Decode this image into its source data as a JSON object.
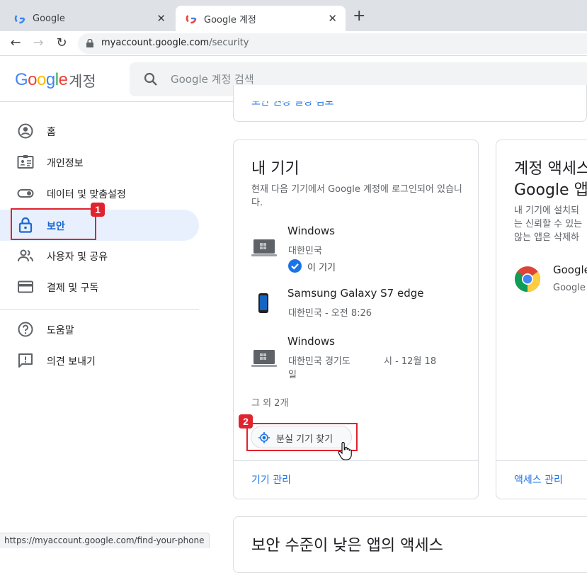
{
  "browser": {
    "tabs": [
      {
        "title": "Google"
      },
      {
        "title": "Google 계정"
      }
    ],
    "new_tab": "+",
    "url_domain": "myaccount.google.com",
    "url_path": "/security",
    "status_url": "https://myaccount.google.com/find-your-phone"
  },
  "header": {
    "logo_letters": [
      "G",
      "o",
      "o",
      "g",
      "l",
      "e"
    ],
    "product": "계정",
    "search_placeholder": "Google 계정 검색"
  },
  "sidebar": {
    "items": [
      {
        "label": "홈",
        "icon": "account-circle-icon"
      },
      {
        "label": "개인정보",
        "icon": "id-card-icon"
      },
      {
        "label": "데이터 및 맞춤설정",
        "icon": "toggle-icon"
      },
      {
        "label": "보안",
        "icon": "lock-icon",
        "active": true
      },
      {
        "label": "사용자 및 공유",
        "icon": "people-icon"
      },
      {
        "label": "결제 및 구독",
        "icon": "credit-card-icon"
      }
    ],
    "footer": [
      {
        "label": "도움말",
        "icon": "help-icon"
      },
      {
        "label": "의견 보내기",
        "icon": "feedback-icon"
      }
    ]
  },
  "prev_card": {
    "link": "보안 권장 설정 검토"
  },
  "devices_card": {
    "title": "내 기기",
    "description": "현재 다음 기기에서 Google 계정에 로그인되어 있습니다.",
    "devices": [
      {
        "name": "Windows",
        "detail": "대한민국",
        "extra": "이 기기",
        "icon": "laptop-icon"
      },
      {
        "name": "Samsung Galaxy S7 edge",
        "detail": "대한민국 - 오전 8:26",
        "icon": "phone-icon"
      },
      {
        "name": "Windows",
        "detail": "대한민국 경기도",
        "detail_right": "시 - 12월 18",
        "detail_wrap": "일",
        "icon": "laptop-icon"
      }
    ],
    "more": "그 외 2개",
    "find_button": "분실 기기 찾기",
    "manage_link": "기기 관리"
  },
  "access_card": {
    "title_line1": "계정 액세스",
    "title_line2": "Google 앱",
    "desc_line1": "내 기기에 설치되",
    "desc_line2": "는 신뢰할 수 있는",
    "desc_line3": "않는 앱은 삭제하",
    "app_name": "Google",
    "app_sub": "Google",
    "manage_link": "액세스 관리"
  },
  "bottom_card": {
    "title": "보안 수준이 낮은 앱의 액세스"
  },
  "annotations": {
    "badge1": "1",
    "badge2": "2"
  },
  "colors": {
    "accent": "#1a73e8",
    "active_bg": "#e8f0fe",
    "annotation_red": "#e0232e"
  }
}
